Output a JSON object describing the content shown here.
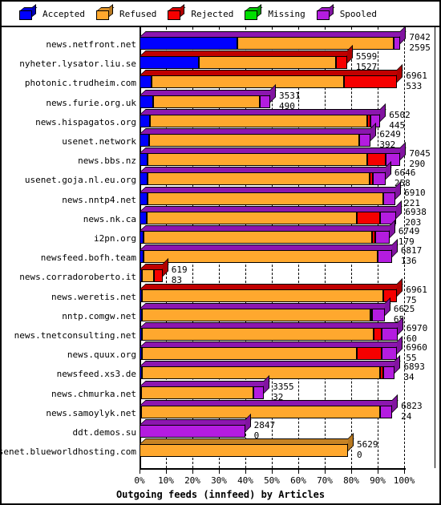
{
  "legend": {
    "items": [
      {
        "label": "Accepted",
        "color": "#0000ff",
        "icon": "cube-icon"
      },
      {
        "label": "Refused",
        "color": "#ffa82e",
        "icon": "cube-icon"
      },
      {
        "label": "Rejected",
        "color": "#f60000",
        "icon": "cube-icon"
      },
      {
        "label": "Missing",
        "color": "#00e000",
        "icon": "cube-icon"
      },
      {
        "label": "Spooled",
        "color": "#b41ce0",
        "icon": "cube-icon"
      }
    ]
  },
  "chart_data": {
    "type": "bar",
    "orientation": "horizontal",
    "stacked": true,
    "title": "Outgoing feeds (innfeed) by Articles",
    "xlabel": "Outgoing feeds (innfeed) by Articles",
    "ylabel": "",
    "xlim": [
      0,
      100
    ],
    "xunit": "%",
    "grid": true,
    "legend_position": "top",
    "tick_labels": [
      "0%",
      "10%",
      "20%",
      "30%",
      "40%",
      "50%",
      "60%",
      "70%",
      "80%",
      "90%",
      "100%"
    ],
    "tick_values": [
      0,
      10,
      20,
      30,
      40,
      50,
      60,
      70,
      80,
      90,
      100
    ],
    "series_names": [
      "Accepted",
      "Refused",
      "Rejected",
      "Missing",
      "Spooled"
    ],
    "series_colors": [
      "#0000ff",
      "#ffa82e",
      "#f60000",
      "#00e000",
      "#b41ce0"
    ],
    "categories": [
      "news.netfront.net",
      "nyheter.lysator.liu.se",
      "photonic.trudheim.com",
      "news.furie.org.uk",
      "news.hispagatos.org",
      "usenet.network",
      "news.bbs.nz",
      "usenet.goja.nl.eu.org",
      "news.nntp4.net",
      "news.nk.ca",
      "i2pn.org",
      "newsfeed.bofh.team",
      "news.corradoroberto.it",
      "news.weretis.net",
      "nntp.comgw.net",
      "news.tnetconsulting.net",
      "news.quux.org",
      "newsfeed.xs3.de",
      "news.chmurka.net",
      "news.samoylyk.net",
      "ddt.demos.su",
      "usenet.blueworldhosting.com"
    ],
    "rows": [
      {
        "label": "news.netfront.net",
        "total": 7042,
        "second": 2595,
        "pct_total": 98.6,
        "segments": [
          {
            "name": "Accepted",
            "pct": 36.9
          },
          {
            "name": "Refused",
            "pct": 59.2
          },
          {
            "name": "Spooled",
            "pct": 2.5
          }
        ]
      },
      {
        "label": "nyheter.lysator.liu.se",
        "total": 5599,
        "second": 1527,
        "pct_total": 78.4,
        "segments": [
          {
            "name": "Accepted",
            "pct": 22.5
          },
          {
            "name": "Refused",
            "pct": 51.8
          },
          {
            "name": "Rejected",
            "pct": 4.1
          }
        ]
      },
      {
        "label": "photonic.trudheim.com",
        "total": 6961,
        "second": 533,
        "pct_total": 97.4,
        "segments": [
          {
            "name": "Accepted",
            "pct": 4.4
          },
          {
            "name": "Refused",
            "pct": 73.0
          },
          {
            "name": "Rejected",
            "pct": 20.0
          }
        ]
      },
      {
        "label": "news.furie.org.uk",
        "total": 3531,
        "second": 490,
        "pct_total": 49.4,
        "segments": [
          {
            "name": "Accepted",
            "pct": 5.0
          },
          {
            "name": "Refused",
            "pct": 40.4
          },
          {
            "name": "Spooled",
            "pct": 4.0
          }
        ]
      },
      {
        "label": "news.hispagatos.org",
        "total": 6502,
        "second": 445,
        "pct_total": 91.0,
        "segments": [
          {
            "name": "Accepted",
            "pct": 4.0
          },
          {
            "name": "Refused",
            "pct": 82.0
          },
          {
            "name": "Rejected",
            "pct": 1.3
          },
          {
            "name": "Spooled",
            "pct": 3.7
          }
        ]
      },
      {
        "label": "usenet.network",
        "total": 6249,
        "second": 392,
        "pct_total": 87.4,
        "segments": [
          {
            "name": "Accepted",
            "pct": 3.5
          },
          {
            "name": "Refused",
            "pct": 79.4
          },
          {
            "name": "Spooled",
            "pct": 4.5
          }
        ]
      },
      {
        "label": "news.bbs.nz",
        "total": 7045,
        "second": 290,
        "pct_total": 98.6,
        "segments": [
          {
            "name": "Accepted",
            "pct": 3.0
          },
          {
            "name": "Refused",
            "pct": 83.0
          },
          {
            "name": "Rejected",
            "pct": 7.0
          },
          {
            "name": "Spooled",
            "pct": 5.6
          }
        ]
      },
      {
        "label": "usenet.goja.nl.eu.org",
        "total": 6646,
        "second": 258,
        "pct_total": 93.0,
        "segments": [
          {
            "name": "Accepted",
            "pct": 3.0
          },
          {
            "name": "Refused",
            "pct": 84.0
          },
          {
            "name": "Rejected",
            "pct": 1.2
          },
          {
            "name": "Spooled",
            "pct": 4.8
          }
        ]
      },
      {
        "label": "news.nntp4.net",
        "total": 6910,
        "second": 221,
        "pct_total": 96.7,
        "segments": [
          {
            "name": "Accepted",
            "pct": 3.0
          },
          {
            "name": "Refused",
            "pct": 89.0
          },
          {
            "name": "Spooled",
            "pct": 4.7
          }
        ]
      },
      {
        "label": "news.nk.ca",
        "total": 6938,
        "second": 203,
        "pct_total": 97.1,
        "segments": [
          {
            "name": "Accepted",
            "pct": 2.8
          },
          {
            "name": "Refused",
            "pct": 79.2
          },
          {
            "name": "Rejected",
            "pct": 9.0
          },
          {
            "name": "Spooled",
            "pct": 6.1
          }
        ]
      },
      {
        "label": "i2pn.org",
        "total": 6749,
        "second": 179,
        "pct_total": 94.5,
        "segments": [
          {
            "name": "Accepted",
            "pct": 1.5
          },
          {
            "name": "Refused",
            "pct": 86.5
          },
          {
            "name": "Rejected",
            "pct": 1.2
          },
          {
            "name": "Spooled",
            "pct": 5.3
          }
        ]
      },
      {
        "label": "newsfeed.bofh.team",
        "total": 6817,
        "second": 136,
        "pct_total": 95.4,
        "segments": [
          {
            "name": "Accepted",
            "pct": 1.5
          },
          {
            "name": "Refused",
            "pct": 88.5
          },
          {
            "name": "Spooled",
            "pct": 5.4
          }
        ]
      },
      {
        "label": "news.corradoroberto.it",
        "total": 619,
        "second": 83,
        "pct_total": 8.7,
        "segments": [
          {
            "name": "Accepted",
            "pct": 1.0
          },
          {
            "name": "Refused",
            "pct": 4.6
          },
          {
            "name": "Rejected",
            "pct": 3.1
          }
        ]
      },
      {
        "label": "news.weretis.net",
        "total": 6961,
        "second": 75,
        "pct_total": 97.4,
        "segments": [
          {
            "name": "Accepted",
            "pct": 1.0
          },
          {
            "name": "Refused",
            "pct": 91.0
          },
          {
            "name": "Rejected",
            "pct": 5.4
          }
        ]
      },
      {
        "label": "nntp.comgw.net",
        "total": 6625,
        "second": 65,
        "pct_total": 92.7,
        "segments": [
          {
            "name": "Accepted",
            "pct": 1.0
          },
          {
            "name": "Refused",
            "pct": 86.2
          },
          {
            "name": "Rejected",
            "pct": 0.8
          },
          {
            "name": "Spooled",
            "pct": 4.7
          }
        ]
      },
      {
        "label": "news.tnetconsulting.net",
        "total": 6970,
        "second": 60,
        "pct_total": 97.5,
        "segments": [
          {
            "name": "Accepted",
            "pct": 1.0
          },
          {
            "name": "Refused",
            "pct": 87.5
          },
          {
            "name": "Rejected",
            "pct": 3.0
          },
          {
            "name": "Spooled",
            "pct": 6.0
          }
        ]
      },
      {
        "label": "news.quux.org",
        "total": 6960,
        "second": 55,
        "pct_total": 97.4,
        "segments": [
          {
            "name": "Accepted",
            "pct": 1.0
          },
          {
            "name": "Refused",
            "pct": 81.0
          },
          {
            "name": "Rejected",
            "pct": 9.5
          },
          {
            "name": "Spooled",
            "pct": 5.9
          }
        ]
      },
      {
        "label": "newsfeed.xs3.de",
        "total": 6893,
        "second": 34,
        "pct_total": 96.5,
        "segments": [
          {
            "name": "Accepted",
            "pct": 0.8
          },
          {
            "name": "Refused",
            "pct": 90.2
          },
          {
            "name": "Rejected",
            "pct": 1.2
          },
          {
            "name": "Spooled",
            "pct": 4.3
          }
        ]
      },
      {
        "label": "news.chmurka.net",
        "total": 3355,
        "second": 32,
        "pct_total": 47.0,
        "segments": [
          {
            "name": "Accepted",
            "pct": 0.6
          },
          {
            "name": "Refused",
            "pct": 42.4
          },
          {
            "name": "Spooled",
            "pct": 4.0
          }
        ]
      },
      {
        "label": "news.samoylyk.net",
        "total": 6823,
        "second": 24,
        "pct_total": 95.5,
        "segments": [
          {
            "name": "Accepted",
            "pct": 0.6
          },
          {
            "name": "Refused",
            "pct": 90.4
          },
          {
            "name": "Spooled",
            "pct": 4.5
          }
        ]
      },
      {
        "label": "ddt.demos.su",
        "total": 2847,
        "second": 0,
        "pct_total": 39.9,
        "segments": [
          {
            "name": "Spooled",
            "pct": 39.9
          }
        ]
      },
      {
        "label": "usenet.blueworldhosting.com",
        "total": 5629,
        "second": 0,
        "pct_total": 78.8,
        "segments": [
          {
            "name": "Refused",
            "pct": 78.8
          }
        ]
      }
    ]
  },
  "axis": {
    "title": "Outgoing feeds (innfeed) by Articles"
  }
}
